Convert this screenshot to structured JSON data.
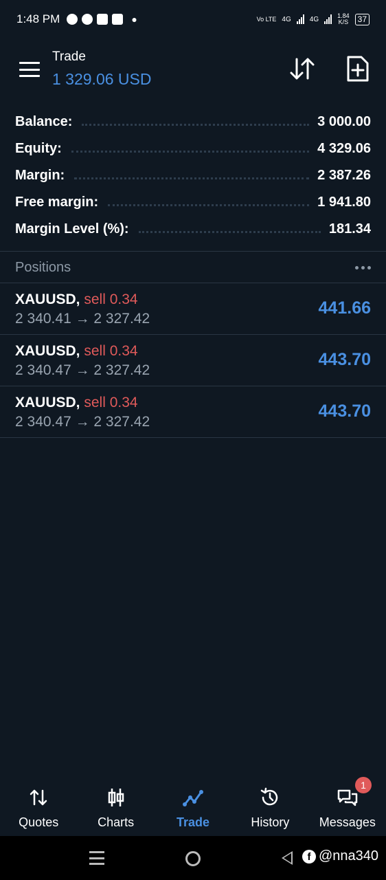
{
  "status_bar": {
    "time": "1:48 PM",
    "network_1": "Vo LTE",
    "network_2": "4G",
    "network_3": "4G",
    "speed_value": "1.84",
    "speed_unit": "K/S",
    "battery": "37"
  },
  "header": {
    "title": "Trade",
    "subtitle": "1 329.06 USD"
  },
  "summary": [
    {
      "label": "Balance:",
      "value": "3 000.00"
    },
    {
      "label": "Equity:",
      "value": "4 329.06"
    },
    {
      "label": "Margin:",
      "value": "2 387.26"
    },
    {
      "label": "Free margin:",
      "value": "1 941.80"
    },
    {
      "label": "Margin Level (%):",
      "value": "181.34"
    }
  ],
  "positions": {
    "title": "Positions",
    "items": [
      {
        "symbol": "XAUUSD,",
        "side": "sell 0.34",
        "prices": "2 340.41 → 2 327.42",
        "profit": "441.66"
      },
      {
        "symbol": "XAUUSD,",
        "side": "sell 0.34",
        "prices": "2 340.47 → 2 327.42",
        "profit": "443.70"
      },
      {
        "symbol": "XAUUSD,",
        "side": "sell 0.34",
        "prices": "2 340.47 → 2 327.42",
        "profit": "443.70"
      }
    ]
  },
  "bottom_nav": {
    "items": [
      {
        "label": "Quotes",
        "icon": "quotes-icon"
      },
      {
        "label": "Charts",
        "icon": "charts-icon"
      },
      {
        "label": "Trade",
        "icon": "trade-icon",
        "active": true
      },
      {
        "label": "History",
        "icon": "history-icon"
      },
      {
        "label": "Messages",
        "icon": "messages-icon",
        "badge": "1"
      }
    ]
  },
  "watermark": "@nna340",
  "colors": {
    "background": "#0f1822",
    "accent": "#4a90e2",
    "sell": "#e05a5a",
    "muted": "#9aa5b1"
  }
}
